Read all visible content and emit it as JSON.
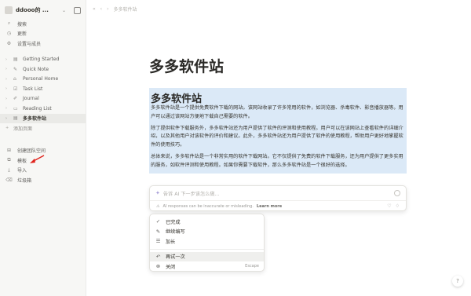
{
  "sidebar": {
    "workspace_name": "ddooo的 ...",
    "top_items": [
      {
        "label": "搜索",
        "icon": "search-icon",
        "glyph": "⌕"
      },
      {
        "label": "更新",
        "icon": "clock-icon",
        "glyph": "◷"
      },
      {
        "label": "设置与成员",
        "icon": "gear-icon",
        "glyph": "⚙"
      }
    ],
    "pages": [
      {
        "label": "Getting Started",
        "glyph": "▤"
      },
      {
        "label": "Quick Note",
        "glyph": "✎"
      },
      {
        "label": "Personal Home",
        "glyph": "⌂"
      },
      {
        "label": "Task List",
        "glyph": "☑"
      },
      {
        "label": "Journal",
        "glyph": "✐"
      },
      {
        "label": "Reading List",
        "glyph": "▭"
      },
      {
        "label": "多多软件站",
        "glyph": "▤"
      }
    ],
    "add_page": "添加页面",
    "bottom_items": [
      {
        "label": "创建团队空间",
        "icon": "team-icon",
        "glyph": "⊞"
      },
      {
        "label": "模板",
        "icon": "template-icon",
        "glyph": "⧉"
      },
      {
        "label": "导入",
        "icon": "import-icon",
        "glyph": "⤓"
      },
      {
        "label": "垃圾箱",
        "icon": "trash-icon",
        "glyph": "🗑"
      }
    ]
  },
  "topbar": {
    "breadcrumb": "多多软件站"
  },
  "page": {
    "title": "多多软件站",
    "heading": "多多软件站",
    "paragraphs": [
      "多多软件站是一个提供免费软件下载的网站。该网站收录了许多常用的软件，如浏览器、杀毒软件、影音播放器等。用户可以通过该网站方便地下载自己需要的软件。",
      "除了提供软件下载服务外，多多软件站还为用户提供了软件的评测和使用教程。用户可以在该网站上查看软件的详细介绍，以及其他用户对该软件的评价和建议。此外，多多软件站还为用户提供了软件的使用教程，帮助用户更好地掌握软件的使用技巧。",
      "总体来说，多多软件站是一个非常实用的软件下载网站。它不仅提供了免费的软件下载服务，还为用户提供了更多实用的服务，如软件评测和使用教程。如果你需要下载软件，那么多多软件站是一个很好的选择。"
    ]
  },
  "ai": {
    "placeholder": "告诉 AI 下一步该怎么做...",
    "disclaimer": "AI responses can be inaccurate or misleading.",
    "learn_more": "Learn more"
  },
  "menu": {
    "items": [
      {
        "label": "已完成",
        "icon": "check-icon",
        "glyph": "✓"
      },
      {
        "label": "继续编写",
        "icon": "pen-icon",
        "glyph": "✎"
      },
      {
        "label": "加长",
        "icon": "lines-icon",
        "glyph": "☰"
      }
    ],
    "retry": {
      "label": "再试一次",
      "icon": "retry-icon",
      "glyph": "↶"
    },
    "close": {
      "label": "关闭",
      "icon": "close-icon",
      "glyph": "⊗",
      "shortcut": "Escape"
    }
  },
  "colors": {
    "selection": "#dbe9f7",
    "annotation_arrow": "#e0221b"
  }
}
